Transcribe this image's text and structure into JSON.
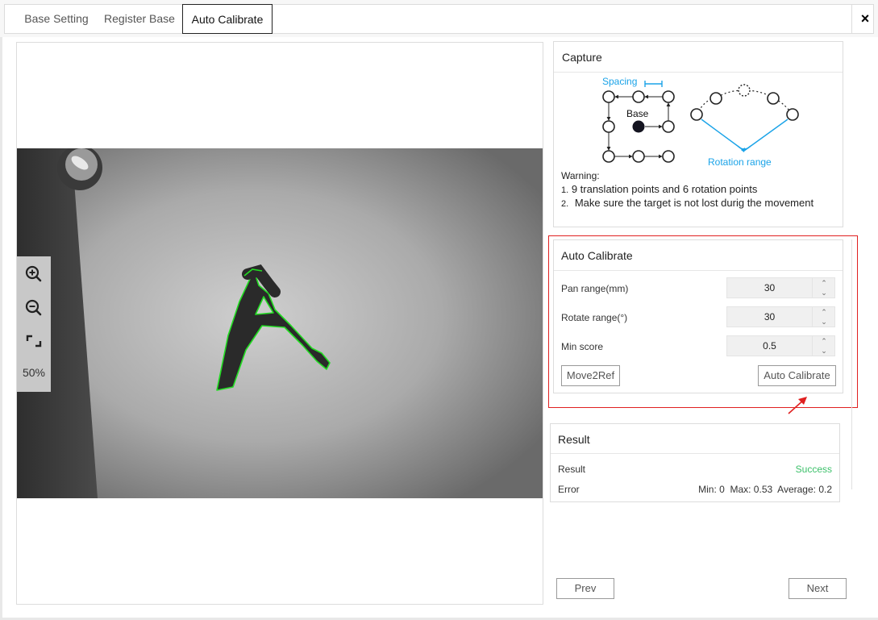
{
  "tabs": [
    {
      "label": "Base Setting",
      "active": false
    },
    {
      "label": "Register Base",
      "active": false
    },
    {
      "label": "Auto Calibrate",
      "active": true
    }
  ],
  "close_label": "×",
  "viewer": {
    "zoom_level": "50%",
    "target_letter": "A"
  },
  "capture": {
    "title": "Capture",
    "diagram": {
      "spacing_label": "Spacing",
      "base_label": "Base",
      "rotation_label": "Rotation range"
    },
    "warning_title": "Warning:",
    "warnings": [
      {
        "num": "1.",
        "text": "9 translation points and 6 rotation points"
      },
      {
        "num": "2.",
        "text": "Make sure the target is not lost durig the movement"
      }
    ]
  },
  "auto_calibrate": {
    "title": "Auto Calibrate",
    "fields": [
      {
        "label": "Pan range(mm)",
        "value": "30"
      },
      {
        "label": "Rotate range(°)",
        "value": "30"
      },
      {
        "label": "Min score",
        "value": "0.5"
      }
    ],
    "move_button": "Move2Ref",
    "calibrate_button": "Auto Calibrate"
  },
  "result": {
    "title": "Result",
    "result_label": "Result",
    "result_value": "Success",
    "error_label": "Error",
    "error_value": "Min: 0  Max: 0.53  Average: 0.2"
  },
  "nav": {
    "prev": "Prev",
    "next": "Next"
  },
  "colors": {
    "accent_blue": "#1aa3e8",
    "success_green": "#3cc06a",
    "highlight_red": "#e02020",
    "contour_green": "#22dd22"
  }
}
